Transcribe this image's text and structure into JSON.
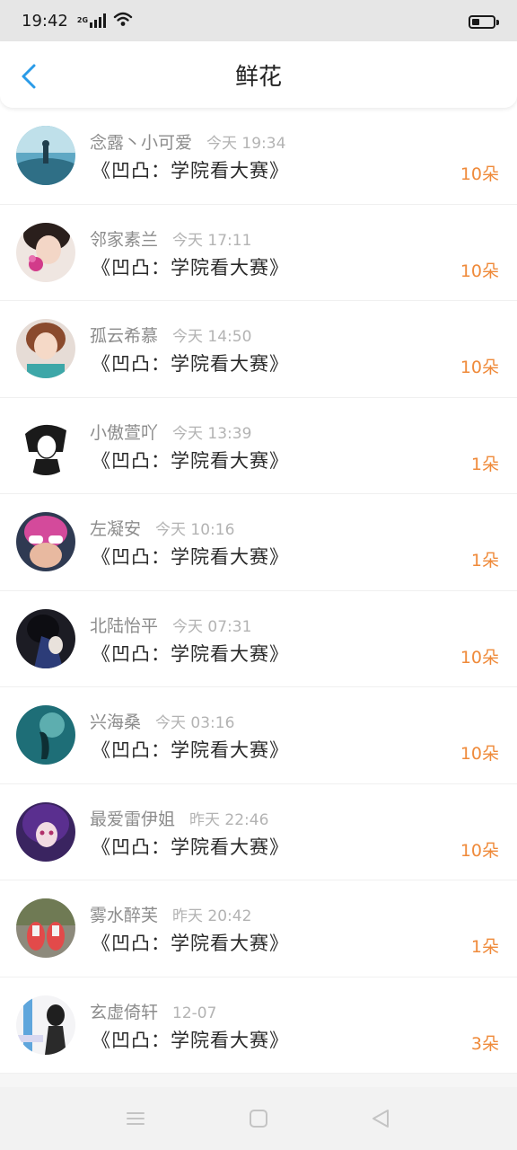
{
  "status_bar": {
    "time": "19:42",
    "network_tag": "2G"
  },
  "header": {
    "title": "鲜花"
  },
  "colors": {
    "accent_blue": "#2a9be8",
    "count_orange": "#ef8a3a"
  },
  "icons": {
    "back": "chevron-left-icon",
    "menu": "menu-icon",
    "home": "home-square-icon",
    "back_triangle": "back-triangle-icon"
  },
  "records": [
    {
      "name": "念露丶小可爱",
      "time": "今天 19:34",
      "title": "《凹凸：学院看大赛》",
      "count": "10朵"
    },
    {
      "name": "邻家素兰",
      "time": "今天 17:11",
      "title": "《凹凸：学院看大赛》",
      "count": "10朵"
    },
    {
      "name": "孤云希慕",
      "time": "今天 14:50",
      "title": "《凹凸：学院看大赛》",
      "count": "10朵"
    },
    {
      "name": "小傲萱吖",
      "time": "今天 13:39",
      "title": "《凹凸：学院看大赛》",
      "count": "1朵"
    },
    {
      "name": "左凝安",
      "time": "今天 10:16",
      "title": "《凹凸：学院看大赛》",
      "count": "1朵"
    },
    {
      "name": "北陆怡平",
      "time": "今天 07:31",
      "title": "《凹凸：学院看大赛》",
      "count": "10朵"
    },
    {
      "name": "兴海桑",
      "time": "今天 03:16",
      "title": "《凹凸：学院看大赛》",
      "count": "10朵"
    },
    {
      "name": "最爱雷伊姐",
      "time": "昨天 22:46",
      "title": "《凹凸：学院看大赛》",
      "count": "10朵"
    },
    {
      "name": "雾水醉芙",
      "time": "昨天 20:42",
      "title": "《凹凸：学院看大赛》",
      "count": "1朵"
    },
    {
      "name": "玄虚倚轩",
      "time": "12-07",
      "title": "《凹凸：学院看大赛》",
      "count": "3朵"
    }
  ]
}
